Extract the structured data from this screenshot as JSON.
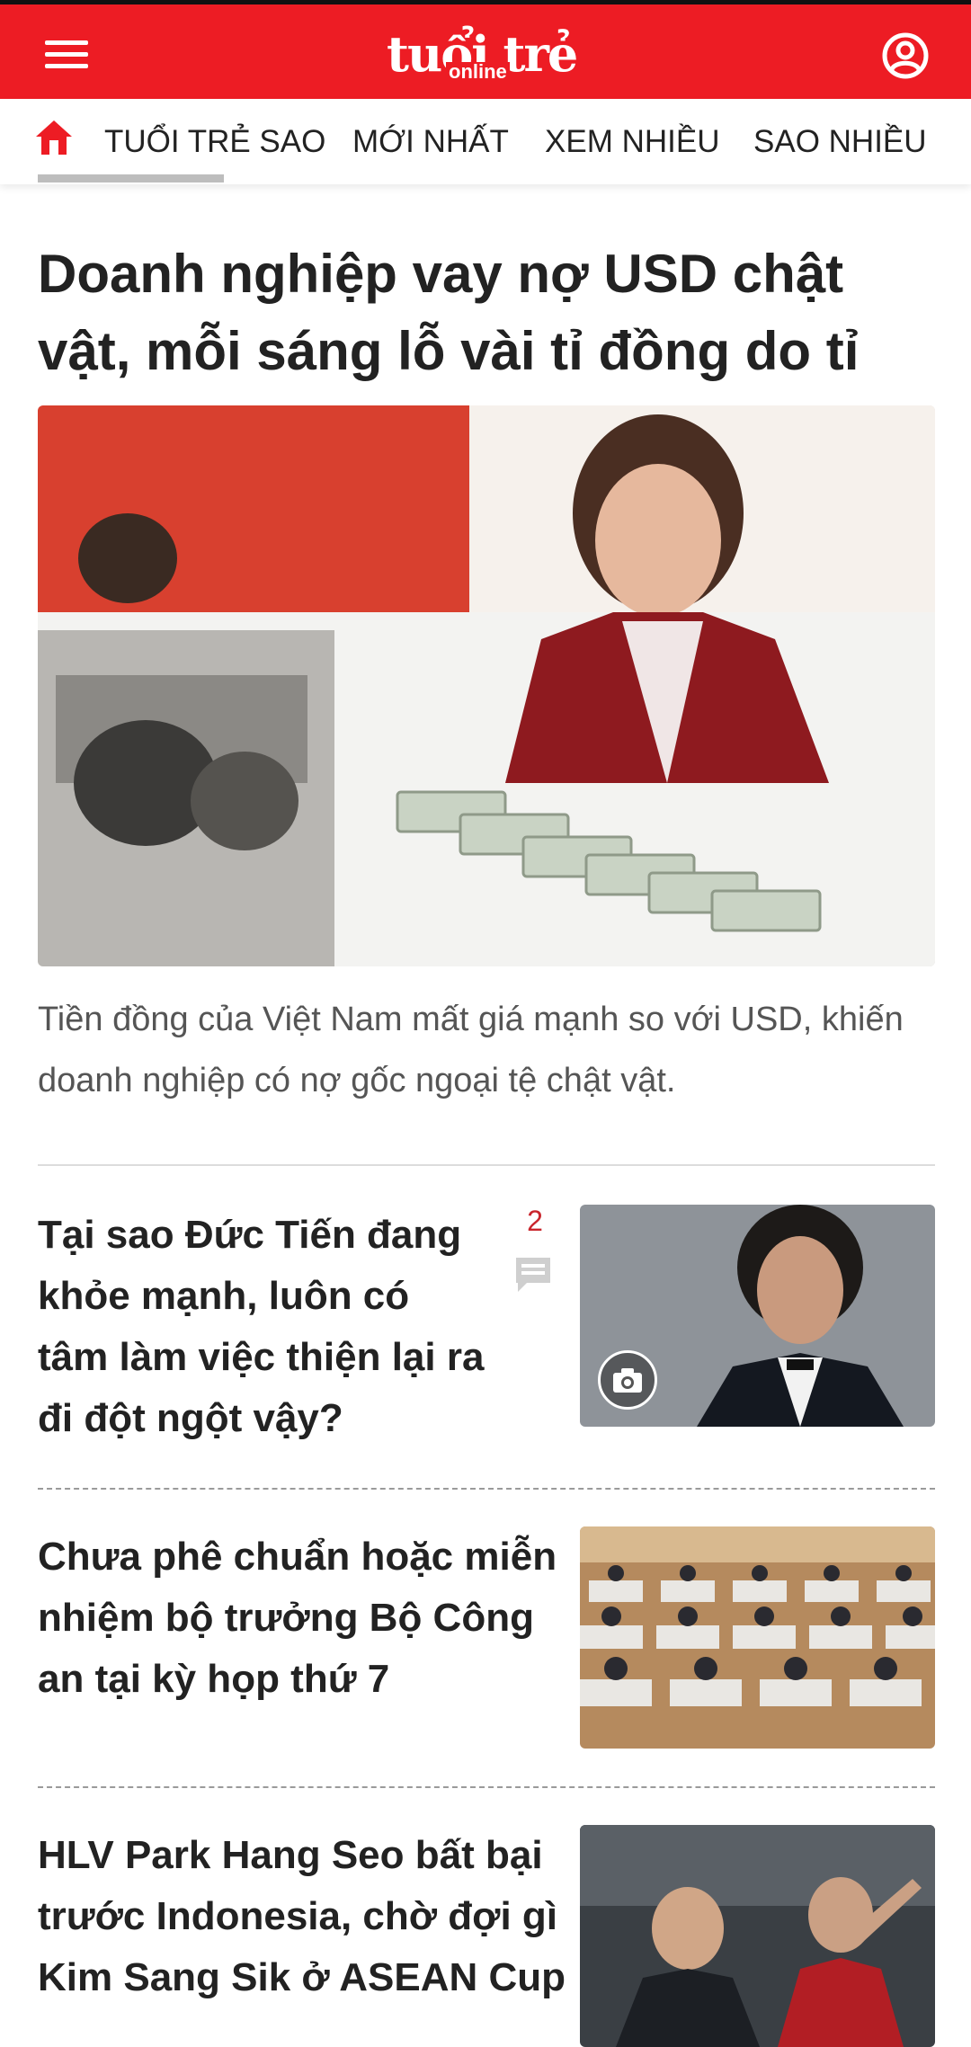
{
  "header": {
    "logo_main": "tuổi trẻ",
    "logo_sub": "online"
  },
  "nav": {
    "items": [
      "TUỔI TRẺ SAO",
      "MỚI NHẤT",
      "XEM NHIỀU",
      "SAO NHIỀU"
    ]
  },
  "main_article": {
    "title": "Doanh nghiệp vay nợ USD chật vật, mỗi sáng lỗ vài tỉ đồng do tỉ giá",
    "caption": "Tiền đồng của Việt Nam mất giá mạnh so với USD, khiến doanh nghiệp có nợ gốc ngoại tệ chật vật."
  },
  "articles": [
    {
      "title": "Tại sao Đức Tiến đang khỏe mạnh, luôn có tâm làm việc thiện lại ra đi đột ngột vậy?",
      "comment_count": "2"
    },
    {
      "title": "Chưa phê chuẩn hoặc miễn nhiệm bộ trưởng Bộ Công an tại kỳ họp thứ 7"
    },
    {
      "title": "HLV Park Hang Seo bất bại trước Indonesia, chờ đợi gì Kim Sang Sik ở ASEAN Cup"
    }
  ],
  "colors": {
    "brand_red": "#ed1c24",
    "comment_red": "#c9252c"
  },
  "icons": {
    "menu": "hamburger-icon",
    "account": "user-circle-icon",
    "home": "home-icon",
    "comment": "comment-bubble-icon",
    "gallery": "camera-icon"
  }
}
